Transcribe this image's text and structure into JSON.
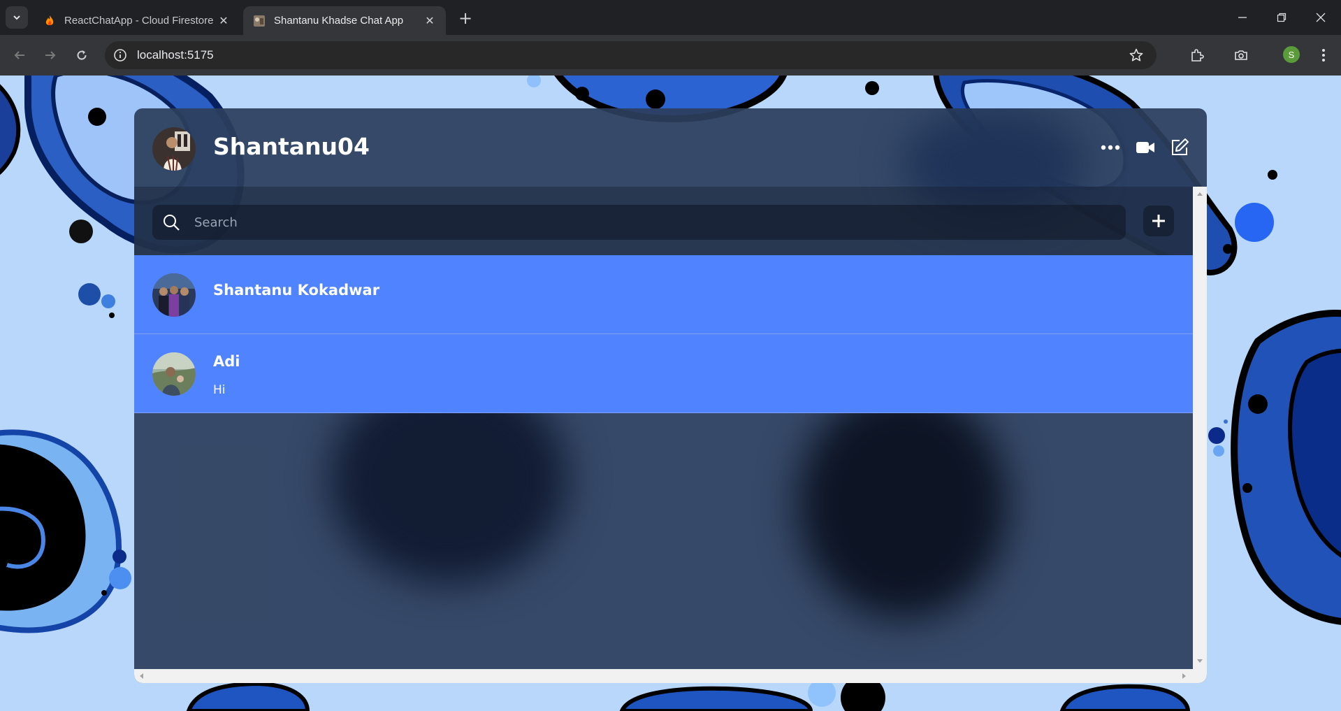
{
  "browser": {
    "tabs": [
      {
        "title": "ReactChatApp - Cloud Firestore",
        "active": false
      },
      {
        "title": "Shantanu Khadse Chat App",
        "active": true
      }
    ],
    "url": "localhost:5175",
    "profile_initial": "S"
  },
  "app": {
    "current_user": {
      "username": "Shantanu04"
    },
    "search": {
      "placeholder": "Search",
      "value": ""
    },
    "chats": [
      {
        "name": "Shantanu Kokadwar",
        "last_message": ""
      },
      {
        "name": "Adi",
        "last_message": "Hi"
      }
    ],
    "icons": {
      "more": "more-icon",
      "video": "video-icon",
      "edit": "edit-icon",
      "search": "search-icon",
      "add": "plus-icon"
    }
  },
  "colors": {
    "chat_item_bg": "#5083ff",
    "panel_bg": "#2c3e5c",
    "page_bg": "#b9d6fb"
  }
}
